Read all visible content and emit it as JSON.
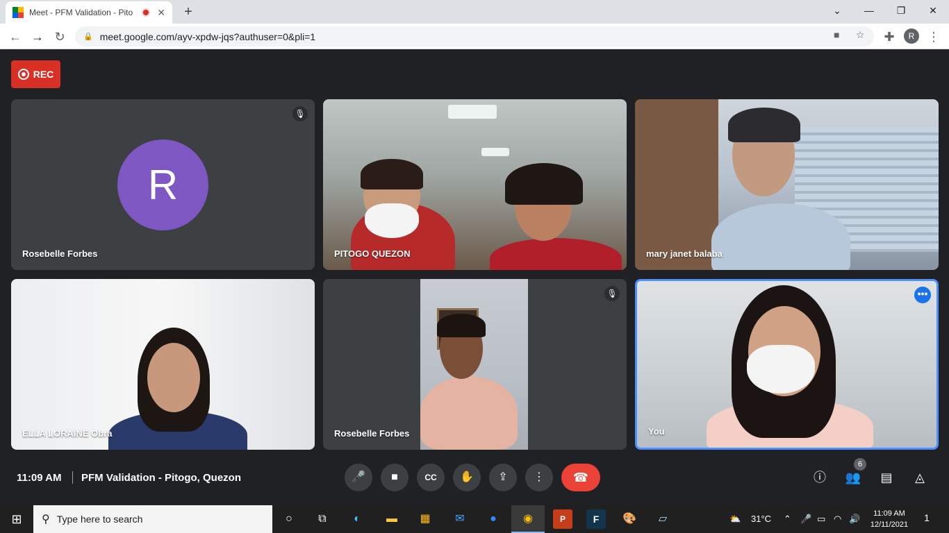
{
  "browser": {
    "tab_title": "Meet - PFM Validation - Pito",
    "tab_close": "✕",
    "new_tab": "+",
    "url": "meet.google.com/ayv-xpdw-jqs?authuser=0&pli=1",
    "profile_initial": "R",
    "window_controls": {
      "dropdown": "⌄",
      "minimize": "—",
      "restore": "❐",
      "close": "✕"
    }
  },
  "meet": {
    "rec_label": "REC",
    "participants": [
      {
        "name": "Rosebelle Forbes",
        "avatar_initial": "R",
        "muted": true,
        "video": false
      },
      {
        "name": "PITOGO QUEZON",
        "muted": false,
        "video": true
      },
      {
        "name": "mary janet balaba",
        "muted": false,
        "video": true
      },
      {
        "name": "ELLA LORAINE Obra",
        "muted": false,
        "video": true
      },
      {
        "name": "Rosebelle Forbes",
        "muted": true,
        "video": true
      },
      {
        "name": "You",
        "muted": false,
        "video": true
      }
    ],
    "more_options": "•••",
    "clock": "11:09 AM",
    "meeting_title": "PFM Validation - Pitogo, Quezon",
    "people_count": "6"
  },
  "taskbar": {
    "search_placeholder": "Type here to search",
    "weather": "31°C",
    "time": "11:09 AM",
    "date": "12/11/2021",
    "notification_count": "1"
  },
  "colors": {
    "meet_bg": "#202124",
    "rec_red": "#d93025",
    "end_call": "#ea4335",
    "avatar_purple": "#7e57c2",
    "active_border": "#4d90fe"
  }
}
